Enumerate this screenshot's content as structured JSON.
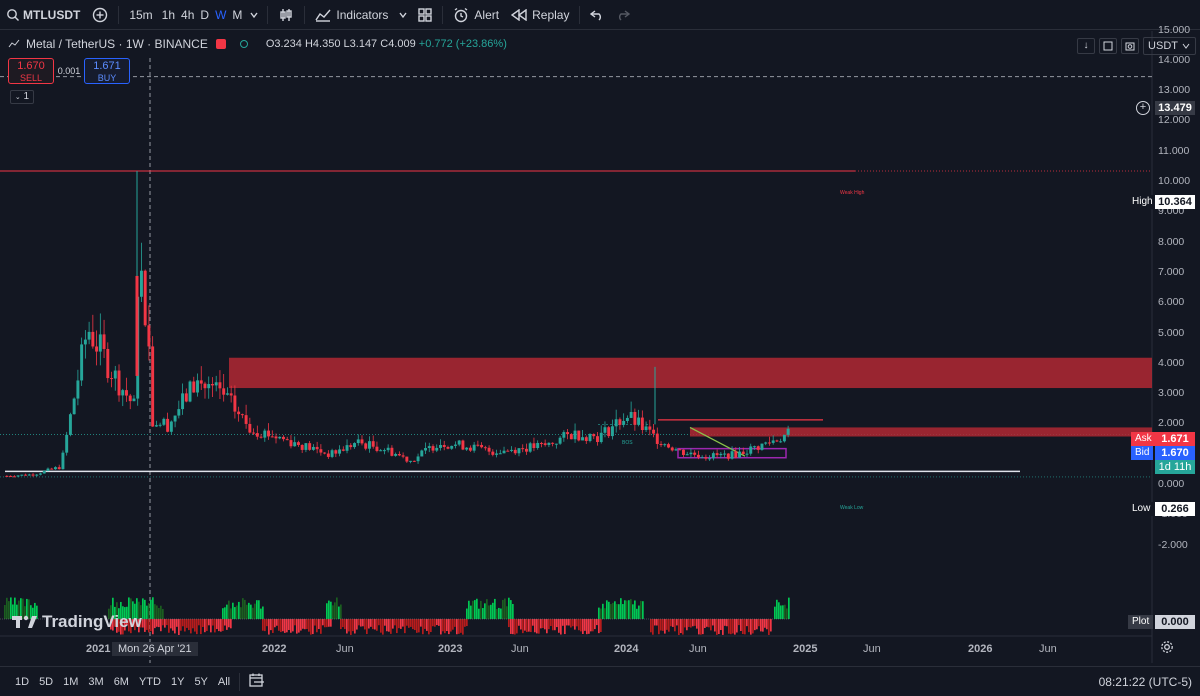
{
  "toolbar": {
    "symbol": "MTLUSDT",
    "intervals": [
      "15m",
      "1h",
      "4h",
      "D",
      "W",
      "M"
    ],
    "active_interval": "W",
    "indicators_label": "Indicators",
    "alert_label": "Alert",
    "replay_label": "Replay"
  },
  "legend": {
    "title": "Metal / TetherUS · 1W · BINANCE",
    "open": "O3.234",
    "high": "H4.350",
    "low": "L3.147",
    "close": "C4.009",
    "change": "+0.772 (+23.86%)"
  },
  "trade": {
    "sell_price": "1.670",
    "sell_label": "SELL",
    "spread": "0.001",
    "buy_price": "1.671",
    "buy_label": "BUY"
  },
  "series_count": "1",
  "currency": "USDT",
  "price_axis": {
    "ticks": [
      "15.000",
      "14.000",
      "13.000",
      "12.000",
      "11.000",
      "10.000",
      "9.000",
      "8.000",
      "7.000",
      "6.000",
      "5.000",
      "4.000",
      "3.000",
      "2.000",
      "1.000",
      "0.000",
      "-1.000",
      "-2.000"
    ],
    "crosshair_price": "13.479",
    "high_label": "High",
    "high_value": "10.364",
    "low_label": "Low",
    "low_value": "0.266",
    "ask_label": "Ask",
    "ask_value": "1.671",
    "bid_label": "Bid",
    "bid_value": "1.670",
    "countdown": "1d 11h",
    "plot_label": "Plot",
    "plot_value": "0.000"
  },
  "time_axis": {
    "ticks": [
      "2021",
      "2022",
      "Jun",
      "2023",
      "Jun",
      "2024",
      "Jun",
      "2025",
      "Jun",
      "2026",
      "Jun"
    ],
    "crosshair_date": "Mon 26 Apr '21"
  },
  "annotations": {
    "weak_high": "Weak High",
    "weak_low": "Weak Low",
    "bos": "BOS"
  },
  "logo": "TradingView",
  "bottom": {
    "ranges": [
      "1D",
      "5D",
      "1M",
      "3M",
      "6M",
      "YTD",
      "1Y",
      "5Y",
      "All"
    ],
    "clock": "08:21:22 (UTC-5)"
  },
  "colors": {
    "up": "#26a69a",
    "down": "#f23645",
    "supply_zone": "#b22833",
    "demand_box": "#9c27b0",
    "background": "#131722"
  },
  "chart_data": {
    "type": "candlestick",
    "title": "Metal / TetherUS · 1W · BINANCE",
    "ylim": [
      -2.6,
      15.2
    ],
    "x": [
      "2020-11",
      "2021-01",
      "2021-02",
      "2021-03",
      "2021-04",
      "2021-05",
      "2021-06",
      "2021-08",
      "2021-10",
      "2021-12",
      "2022-02",
      "2022-04",
      "2022-06",
      "2022-08",
      "2022-10",
      "2022-12",
      "2023-02",
      "2023-04",
      "2023-06",
      "2023-08",
      "2023-10",
      "2023-12",
      "2024-02",
      "2024-03",
      "2024-04",
      "2024-06",
      "2024-08",
      "2024-10",
      "2024-11",
      "2024-12"
    ],
    "close": [
      0.3,
      0.35,
      0.6,
      5.2,
      3.6,
      2.2,
      2.0,
      3.4,
      3.0,
      1.9,
      1.6,
      1.3,
      1.0,
      1.4,
      1.2,
      0.8,
      1.4,
      1.3,
      1.1,
      1.2,
      1.3,
      1.7,
      1.6,
      2.3,
      1.6,
      1.1,
      0.95,
      1.0,
      1.3,
      1.67
    ],
    "weekly_high": 10.364,
    "weekly_low": 0.266,
    "zones": {
      "supply": [
        3.2,
        4.2
      ],
      "minor_supply": [
        1.6,
        1.9
      ],
      "demand": [
        0.9,
        1.2
      ]
    }
  }
}
